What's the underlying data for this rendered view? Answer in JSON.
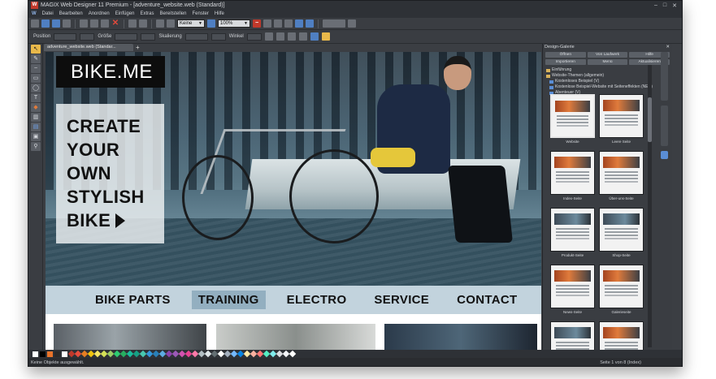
{
  "window": {
    "title": "MAGIX Web Designer 11 Premium - [adventure_website.web (Standard)]",
    "controls": [
      "–",
      "□",
      "✕"
    ]
  },
  "menu": {
    "items": [
      "Datei",
      "Bearbeiten",
      "Anordnen",
      "Einfügen",
      "Extras",
      "Bereitstellen",
      "Fenster",
      "Hilfe"
    ]
  },
  "toolbar": {
    "style_select": "Keine",
    "zoom_select": "100%"
  },
  "infobar": {
    "position_label": "Position",
    "size_label": "Größe",
    "scale_label": "Skalierung",
    "angle_label": "Winkel"
  },
  "document": {
    "tab_label": "adventure_website.web (Standar...",
    "plus": "+"
  },
  "site": {
    "logo": "BIKE.ME",
    "claim_lines": [
      "CREATE",
      "YOUR",
      "OWN",
      "STYLISH",
      "BIKE"
    ],
    "nav": [
      "BIKE PARTS",
      "TRAINING",
      "ELECTRO",
      "SERVICE",
      "CONTACT"
    ],
    "nav_active": "TRAINING"
  },
  "panel": {
    "title": "Design-Galerie",
    "buttons_row1": [
      "Öffnen",
      "Von Laufwerk",
      "Hilfe"
    ],
    "buttons_row2": [
      "Importieren",
      "Menü",
      "Aktualisieren"
    ],
    "tree": [
      {
        "label": "Einführung",
        "color": "yellow"
      },
      {
        "label": "Website-Themen (allgemein)",
        "color": "yellow"
      },
      {
        "label": "Kostenloses Beispiel (V)",
        "color": "blue"
      },
      {
        "label": "Kostenlose Beispiel-Website mit Seiteneffekten (NEU)",
        "color": "blue"
      },
      {
        "label": "Abenteuer (V)",
        "color": "blue"
      }
    ],
    "gallery": [
      {
        "label": "Website",
        "style": "orange",
        "selected": true
      },
      {
        "label": "Leere Seite",
        "style": "orange",
        "selected": false
      },
      {
        "label": "Index-Seite",
        "style": "orange",
        "selected": false
      },
      {
        "label": "Über-uns-Seite",
        "style": "orange",
        "selected": false
      },
      {
        "label": "Produkt-Seite",
        "style": "plain",
        "selected": false
      },
      {
        "label": "Shop-Seite",
        "style": "plain",
        "selected": false
      },
      {
        "label": "News-Seite",
        "style": "orange",
        "selected": false
      },
      {
        "label": "Galerieseite",
        "style": "orange",
        "selected": false
      },
      {
        "label": "",
        "style": "plain",
        "selected": false
      },
      {
        "label": "",
        "style": "orange",
        "selected": false
      }
    ]
  },
  "palette": [
    "#ffffff",
    "#000000",
    "#e8732a",
    "#2a2a2a",
    "#ffffff",
    "#c0392b",
    "#e74c3c",
    "#e67e22",
    "#f1c40f",
    "#f5e663",
    "#d4e157",
    "#9ccc65",
    "#2ecc71",
    "#27ae60",
    "#1abc9c",
    "#16a085",
    "#48c9b0",
    "#3498db",
    "#2980b9",
    "#5dade2",
    "#8e44ad",
    "#9b59b6",
    "#d252b0",
    "#e84393",
    "#fd79a8",
    "#b2bec3",
    "#dfe6e9",
    "#636e72",
    "#ffffff",
    "#a4b0be",
    "#74b9ff",
    "#0984e3",
    "#ffeaa7",
    "#fab1a0",
    "#ff7675",
    "#55efc4",
    "#81ecec",
    "#dcdde1",
    "#f5f6fa",
    "#ffffff"
  ],
  "status": {
    "left": "Keine Objekte ausgewählt.",
    "right": "Seite 1 von 8 (Index)"
  }
}
